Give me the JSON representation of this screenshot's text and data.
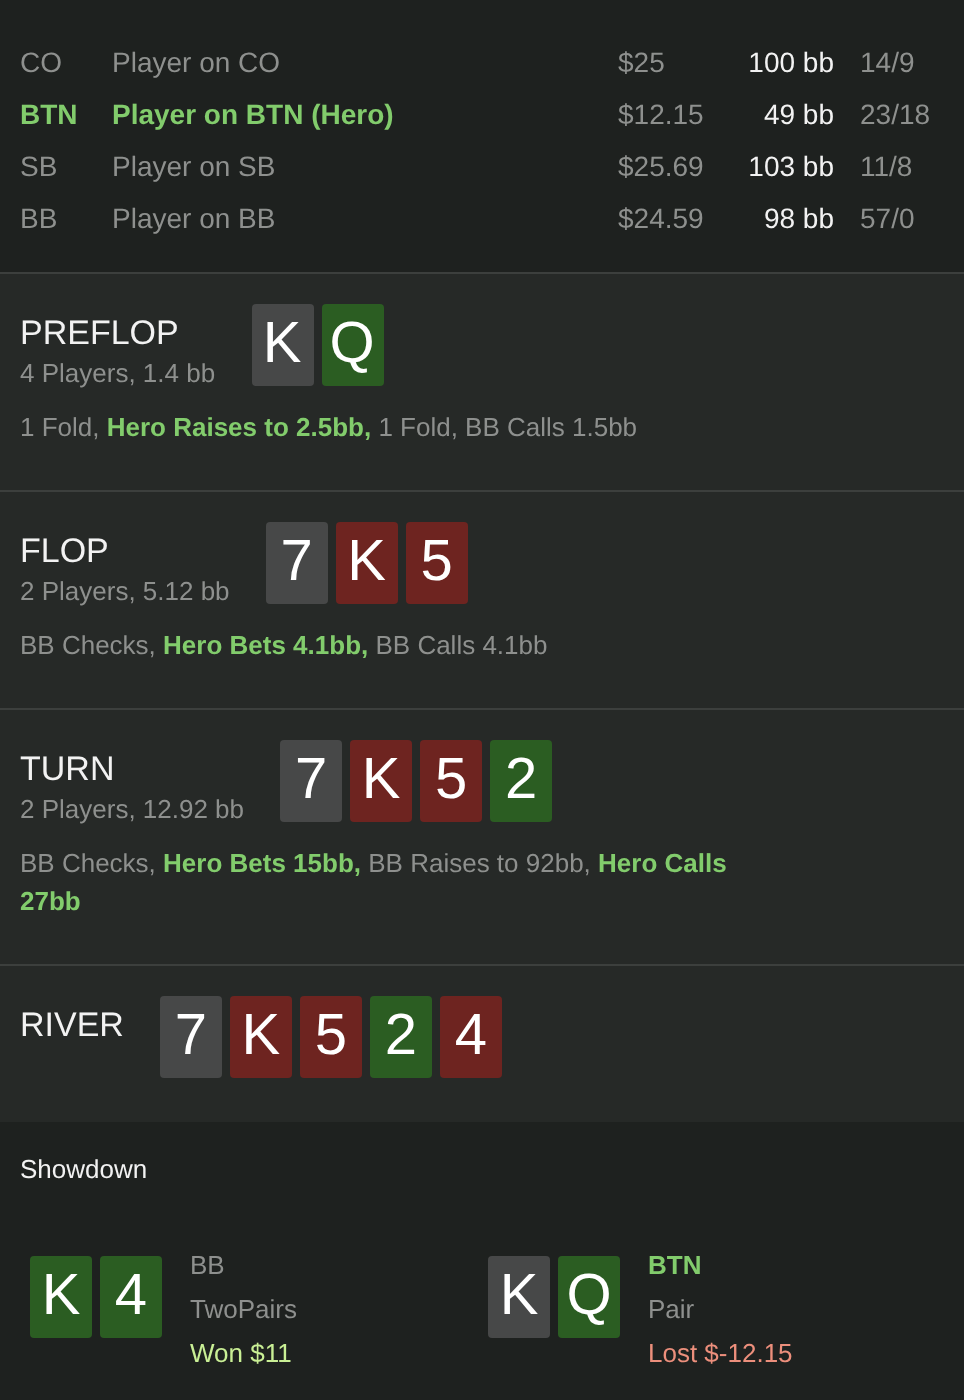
{
  "players": [
    {
      "position": "CO",
      "name": "Player on CO",
      "stack": "$25",
      "bb": "100 bb",
      "stats": "14/9",
      "hero": false
    },
    {
      "position": "BTN",
      "name": "Player on BTN (Hero)",
      "stack": "$12.15",
      "bb": "49 bb",
      "stats": "23/18",
      "hero": true
    },
    {
      "position": "SB",
      "name": "Player on SB",
      "stack": "$25.69",
      "bb": "103 bb",
      "stats": "11/8",
      "hero": false
    },
    {
      "position": "BB",
      "name": "Player on BB",
      "stack": "$24.59",
      "bb": "98 bb",
      "stats": "57/0",
      "hero": false
    }
  ],
  "streets": [
    {
      "name": "PREFLOP",
      "summary": "4 Players, 1.4 bb",
      "cards": [
        {
          "rank": "K",
          "color": "#474848"
        },
        {
          "rank": "Q",
          "color": "#2b5d22"
        }
      ],
      "actions": [
        {
          "text": "1 Fold, ",
          "hero": false
        },
        {
          "text": "Hero Raises to 2.5bb,",
          "hero": true
        },
        {
          "text": " 1 Fold, BB Calls 1.5bb",
          "hero": false
        }
      ]
    },
    {
      "name": "FLOP",
      "summary": "2 Players, 5.12 bb",
      "cards": [
        {
          "rank": "7",
          "color": "#474848"
        },
        {
          "rank": "K",
          "color": "#6e2420"
        },
        {
          "rank": "5",
          "color": "#6e2420"
        }
      ],
      "actions": [
        {
          "text": "BB Checks, ",
          "hero": false
        },
        {
          "text": "Hero Bets 4.1bb,",
          "hero": true
        },
        {
          "text": " BB Calls 4.1bb",
          "hero": false
        }
      ]
    },
    {
      "name": "TURN",
      "summary": "2 Players, 12.92 bb",
      "cards": [
        {
          "rank": "7",
          "color": "#474848"
        },
        {
          "rank": "K",
          "color": "#6e2420"
        },
        {
          "rank": "5",
          "color": "#6e2420"
        },
        {
          "rank": "2",
          "color": "#2b5d22"
        }
      ],
      "actions": [
        {
          "text": "BB Checks, ",
          "hero": false
        },
        {
          "text": "Hero Bets 15bb,",
          "hero": true
        },
        {
          "text": " BB Raises to 92bb, ",
          "hero": false
        },
        {
          "text": "Hero Calls 27bb",
          "hero": true
        }
      ]
    },
    {
      "name": "RIVER",
      "cards": [
        {
          "rank": "7",
          "color": "#474848"
        },
        {
          "rank": "K",
          "color": "#6e2420"
        },
        {
          "rank": "5",
          "color": "#6e2420"
        },
        {
          "rank": "2",
          "color": "#2b5d22"
        },
        {
          "rank": "4",
          "color": "#6e2420"
        }
      ]
    }
  ],
  "showdown": {
    "title": "Showdown",
    "hands": [
      {
        "cards": [
          {
            "rank": "K",
            "color": "#2b5d22"
          },
          {
            "rank": "4",
            "color": "#2b5d22"
          }
        ],
        "position": "BB",
        "hero": false,
        "hand": "TwoPairs",
        "result": "Won $11",
        "color": "#c9ef95"
      },
      {
        "cards": [
          {
            "rank": "K",
            "color": "#474848"
          },
          {
            "rank": "Q",
            "color": "#2b5d22"
          }
        ],
        "position": "BTN",
        "hero": true,
        "hand": "Pair",
        "result": "Lost $-12.15",
        "color": "#ec8f7c"
      }
    ]
  }
}
